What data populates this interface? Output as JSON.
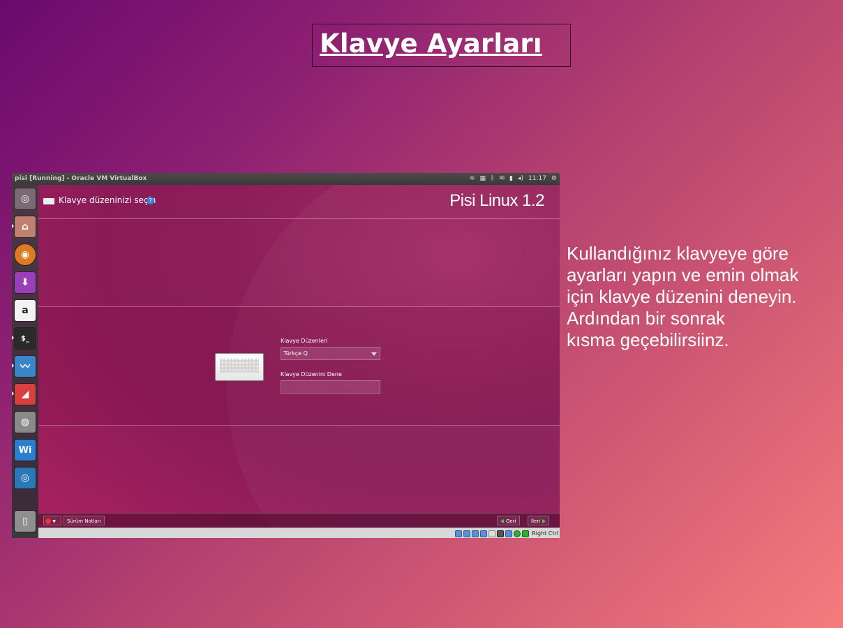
{
  "slide": {
    "title": "Klavye Ayarları",
    "description_lines": [
      "Kullandığınız klavyeye göre",
      "ayarları yapın ve emin olmak",
      "için klavye düzenini deneyin.",
      "Ardından bir sonrak",
      "kısma geçebilirsiinz."
    ]
  },
  "vm": {
    "window_title": "pisi [Running] - Oracle VM VirtualBox",
    "clock": "11:17",
    "launcher_icons": [
      "dash-icon",
      "files-icon",
      "firefox-icon",
      "download-icon",
      "amazon-icon",
      "terminal-icon",
      "system-monitor-icon",
      "app-icon",
      "webcam-icon",
      "wi-icon",
      "audio-icon",
      "trash-icon"
    ],
    "installer": {
      "step_title": "Klavye düzeninizi seçin",
      "brand": "Pisi Linux 1.2",
      "layouts_label": "Klavye Düzenleri",
      "selected_layout": "Türkçe Q",
      "test_label": "Klavye Düzenini Dene",
      "test_value": "",
      "release_notes_button": "Sürüm Notları",
      "back_button": "Geri",
      "next_button": "İleri"
    },
    "statusbar": {
      "host_key": "Right Ctrl"
    }
  },
  "colors": {
    "accent": "#8b1e58",
    "launcher": "#3b2b38"
  }
}
